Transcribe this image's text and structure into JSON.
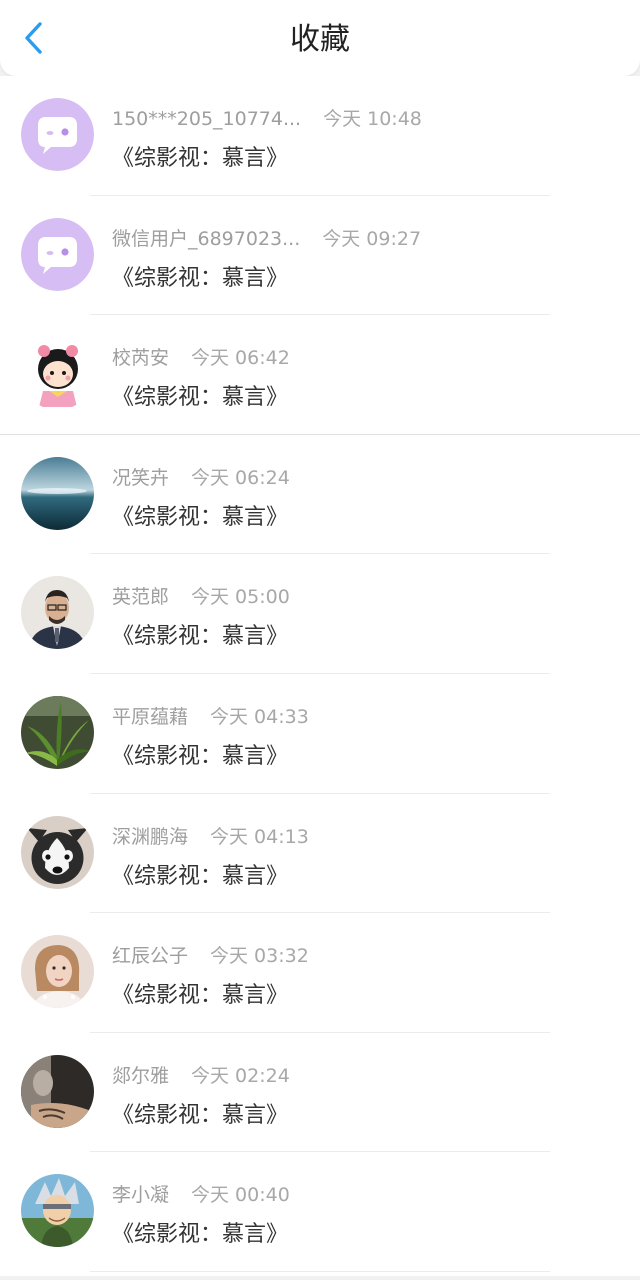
{
  "header": {
    "title": "收藏"
  },
  "items": [
    {
      "user": "150***205_10774...",
      "time": "今天 10:48",
      "book": "《综影视：慕言》",
      "avatar": "chat-bubble-avatar"
    },
    {
      "user": "微信用户_6897023...",
      "time": "今天 09:27",
      "book": "《综影视：慕言》",
      "avatar": "chat-bubble-avatar"
    },
    {
      "user": "校芮安",
      "time": "今天 06:42",
      "book": "《综影视：慕言》",
      "avatar": "cartoon-girl-avatar"
    },
    {
      "user": "况笑卉",
      "time": "今天 06:24",
      "book": "《综影视：慕言》",
      "avatar": "lake-landscape-avatar"
    },
    {
      "user": "英范郎",
      "time": "今天 05:00",
      "book": "《综影视：慕言》",
      "avatar": "man-in-suit-avatar"
    },
    {
      "user": "平原蕴藉",
      "time": "今天 04:33",
      "book": "《综影视：慕言》",
      "avatar": "green-plant-avatar"
    },
    {
      "user": "深渊鹏海",
      "time": "今天 04:13",
      "book": "《综影视：慕言》",
      "avatar": "husky-dog-avatar"
    },
    {
      "user": "红辰公子",
      "time": "今天 03:32",
      "book": "《综影视：慕言》",
      "avatar": "woman-portrait-avatar"
    },
    {
      "user": "郯尔雅",
      "time": "今天 02:24",
      "book": "《综影视：慕言》",
      "avatar": "dark-portrait-avatar"
    },
    {
      "user": "李小凝",
      "time": "今天 00:40",
      "book": "《综影视：慕言》",
      "avatar": "anime-character-avatar"
    }
  ],
  "colors": {
    "accent": "#2a9cf0",
    "bubble_bg": "#d6bdf3",
    "bubble_fg": "#ffffff"
  }
}
